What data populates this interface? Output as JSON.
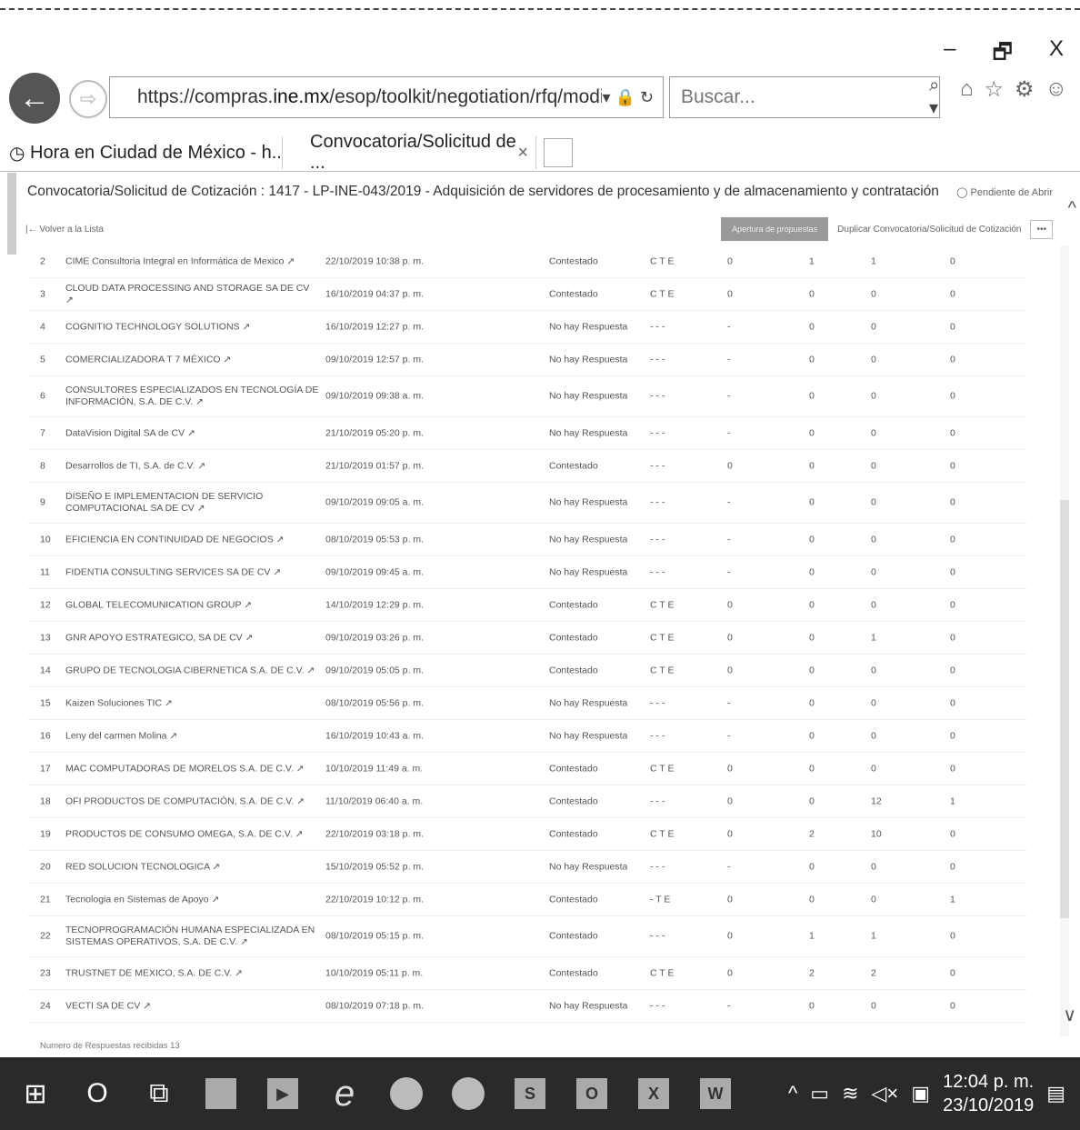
{
  "window": {
    "minimize": "–",
    "restore": "🗗",
    "close": "X"
  },
  "address": {
    "url_prefix": "https://compras.",
    "url_domain": "ine.mx",
    "url_rest": "/esop/toolkit/negotiation/rfq/modifyRf",
    "tools": "▾ 🔒 ↻"
  },
  "search": {
    "placeholder": "Buscar...",
    "icon": "⌕ ▾"
  },
  "tabs": [
    {
      "label": "Hora en Ciudad de México - h..."
    },
    {
      "label": "Convocatoria/Solicitud de ...",
      "close": "×"
    }
  ],
  "page": {
    "title": "Convocatoria/Solicitud de Cotización : 1417 - LP-INE-043/2019 - Adquisición de servidores de procesamiento y de almacenamiento y contratación d...",
    "status": "◯ Pendiente de Abrir",
    "volver": "|← Volver a la Lista",
    "apertura": "Apertura de propuestas",
    "duplicar": "Duplicar Convocatoria/Solicitud de Cotización",
    "more": "•••",
    "footer": "Numero de Respuestas recibidas 13"
  },
  "rows": [
    {
      "n": "2",
      "name": "CIME Consultoria Integral en Informática de Mexico ↗",
      "date": "22/10/2019 10:38 p. m.",
      "status": "Contestado",
      "cte": "C T E",
      "a": "0",
      "b": "1",
      "c": "1",
      "d": "0"
    },
    {
      "n": "3",
      "name": "CLOUD DATA PROCESSING AND STORAGE SA DE CV ↗",
      "date": "16/10/2019 04:37 p. m.",
      "status": "Contestado",
      "cte": "C T E",
      "a": "0",
      "b": "0",
      "c": "0",
      "d": "0"
    },
    {
      "n": "4",
      "name": "COGNITIO TECHNOLOGY SOLUTIONS ↗",
      "date": "16/10/2019 12:27 p. m.",
      "status": "No hay Respuesta",
      "cte": "- - -",
      "a": "-",
      "b": "0",
      "c": "0",
      "d": "0"
    },
    {
      "n": "5",
      "name": "COMERCIALIZADORA T 7 MÉXICO ↗",
      "date": "09/10/2019 12:57 p. m.",
      "status": "No hay Respuesta",
      "cte": "- - -",
      "a": "-",
      "b": "0",
      "c": "0",
      "d": "0"
    },
    {
      "n": "6",
      "name": "CONSULTORES ESPECIALIZADOS EN TECNOLOGÍA DE INFORMACIÓN, S.A. DE C.V. ↗",
      "date": "09/10/2019 09:38 a. m.",
      "status": "No hay Respuesta",
      "cte": "- - -",
      "a": "-",
      "b": "0",
      "c": "0",
      "d": "0",
      "tall": true
    },
    {
      "n": "7",
      "name": "DataVision Digital SA de CV ↗",
      "date": "21/10/2019 05:20 p. m.",
      "status": "No hay Respuesta",
      "cte": "- - -",
      "a": "-",
      "b": "0",
      "c": "0",
      "d": "0"
    },
    {
      "n": "8",
      "name": "Desarrollos de TI, S.A. de C.V. ↗",
      "date": "21/10/2019 01:57 p. m.",
      "status": "Contestado",
      "cte": "- - -",
      "a": "0",
      "b": "0",
      "c": "0",
      "d": "0"
    },
    {
      "n": "9",
      "name": "DISEÑO E IMPLEMENTACION DE SERVICIO COMPUTACIONAL SA DE CV ↗",
      "date": "09/10/2019 09:05 a. m.",
      "status": "No hay Respuesta",
      "cte": "- - -",
      "a": "-",
      "b": "0",
      "c": "0",
      "d": "0",
      "tall": true
    },
    {
      "n": "10",
      "name": "EFICIENCIA EN CONTINUIDAD DE NEGOCIOS ↗",
      "date": "08/10/2019 05:53 p. m.",
      "status": "No hay Respuesta",
      "cte": "- - -",
      "a": "-",
      "b": "0",
      "c": "0",
      "d": "0"
    },
    {
      "n": "11",
      "name": "FIDENTIA CONSULTING SERVICES SA DE CV ↗",
      "date": "09/10/2019 09:45 a. m.",
      "status": "No hay Respuesta",
      "cte": "- - -",
      "a": "-",
      "b": "0",
      "c": "0",
      "d": "0"
    },
    {
      "n": "12",
      "name": "GLOBAL TELECOMUNICATION GROUP ↗",
      "date": "14/10/2019 12:29 p. m.",
      "status": "Contestado",
      "cte": "C T E",
      "a": "0",
      "b": "0",
      "c": "0",
      "d": "0"
    },
    {
      "n": "13",
      "name": "GNR APOYO ESTRATEGICO, SA DE CV ↗",
      "date": "09/10/2019 03:26 p. m.",
      "status": "Contestado",
      "cte": "C T E",
      "a": "0",
      "b": "0",
      "c": "1",
      "d": "0"
    },
    {
      "n": "14",
      "name": "GRUPO DE TECNOLOGIA CIBERNETICA S.A. DE C.V. ↗",
      "date": "09/10/2019 05:05 p. m.",
      "status": "Contestado",
      "cte": "C T E",
      "a": "0",
      "b": "0",
      "c": "0",
      "d": "0"
    },
    {
      "n": "15",
      "name": "Kaizen Soluciones TIC ↗",
      "date": "08/10/2019 05:56 p. m.",
      "status": "No hay Respuesta",
      "cte": "- - -",
      "a": "-",
      "b": "0",
      "c": "0",
      "d": "0"
    },
    {
      "n": "16",
      "name": "Leny del carmen Molina ↗",
      "date": "16/10/2019 10:43 a. m.",
      "status": "No hay Respuesta",
      "cte": "- - -",
      "a": "-",
      "b": "0",
      "c": "0",
      "d": "0"
    },
    {
      "n": "17",
      "name": "MAC COMPUTADORAS DE MORELOS S.A. DE C.V. ↗",
      "date": "10/10/2019 11:49 a. m.",
      "status": "Contestado",
      "cte": "C T E",
      "a": "0",
      "b": "0",
      "c": "0",
      "d": "0"
    },
    {
      "n": "18",
      "name": "OFI PRODUCTOS DE COMPUTACIÓN, S.A. DE C.V. ↗",
      "date": "11/10/2019 06:40 a. m.",
      "status": "Contestado",
      "cte": "- - -",
      "a": "0",
      "b": "0",
      "c": "12",
      "d": "1"
    },
    {
      "n": "19",
      "name": "PRODUCTOS DE CONSUMO OMEGA, S.A. DE C.V. ↗",
      "date": "22/10/2019 03:18 p. m.",
      "status": "Contestado",
      "cte": "C T E",
      "a": "0",
      "b": "2",
      "c": "10",
      "d": "0"
    },
    {
      "n": "20",
      "name": "RED SOLUCION TECNOLOGICA ↗",
      "date": "15/10/2019 05:52 p. m.",
      "status": "No hay Respuesta",
      "cte": "- - -",
      "a": "-",
      "b": "0",
      "c": "0",
      "d": "0"
    },
    {
      "n": "21",
      "name": "Tecnologia en Sistemas de Apoyo ↗",
      "date": "22/10/2019 10:12 p. m.",
      "status": "Contestado",
      "cte": "- T E",
      "a": "0",
      "b": "0",
      "c": "0",
      "d": "1"
    },
    {
      "n": "22",
      "name": "TECNOPROGRAMACIÓN HUMANA ESPECIALIZADA EN SISTEMAS OPERATIVOS, S.A. DE C.V. ↗",
      "date": "08/10/2019 05:15 p. m.",
      "status": "Contestado",
      "cte": "- - -",
      "a": "0",
      "b": "1",
      "c": "1",
      "d": "0",
      "tall": true
    },
    {
      "n": "23",
      "name": "TRUSTNET DE MEXICO, S.A. DE C.V. ↗",
      "date": "10/10/2019 05:11 p. m.",
      "status": "Contestado",
      "cte": "C T E",
      "a": "0",
      "b": "2",
      "c": "2",
      "d": "0"
    },
    {
      "n": "24",
      "name": "VECTI SA DE CV ↗",
      "date": "08/10/2019 07:18 p. m.",
      "status": "No hay Respuesta",
      "cte": "- - -",
      "a": "-",
      "b": "0",
      "c": "0",
      "d": "0"
    }
  ],
  "taskbar": {
    "time": "12:04 p. m.",
    "date": "23/10/2019"
  }
}
